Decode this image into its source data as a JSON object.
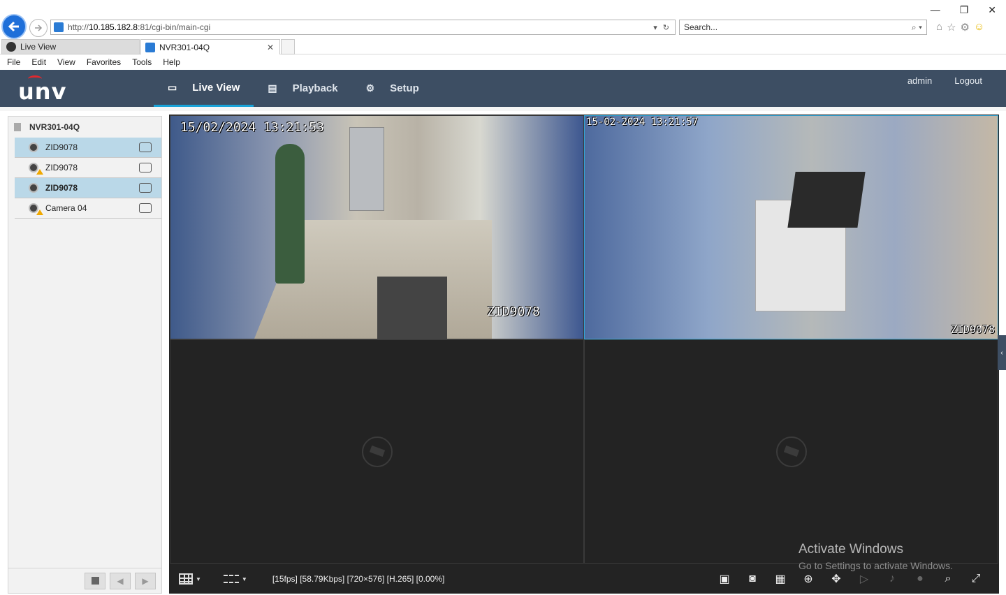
{
  "browser": {
    "url_prefix": "http://",
    "url_host": "10.185.182.8",
    "url_path": ":81/cgi-bin/main-cgi",
    "search_placeholder": "Search...",
    "tabs": [
      {
        "label": "Live View"
      },
      {
        "label": "NVR301-04Q"
      }
    ],
    "menu": [
      "File",
      "Edit",
      "View",
      "Favorites",
      "Tools",
      "Help"
    ]
  },
  "app": {
    "logo": "unv",
    "nav": [
      {
        "label": "Live View",
        "icon": "monitor-icon"
      },
      {
        "label": "Playback",
        "icon": "film-icon"
      },
      {
        "label": "Setup",
        "icon": "gear-icon"
      }
    ],
    "user": "admin",
    "logout": "Logout"
  },
  "sidebar": {
    "root": "NVR301-04Q",
    "cameras": [
      {
        "name": "ZID9078",
        "selected": true,
        "warning": false
      },
      {
        "name": "ZID9078",
        "selected": false,
        "warning": true
      },
      {
        "name": "ZID9078",
        "selected": true,
        "warning": false
      },
      {
        "name": "Camera 04",
        "selected": false,
        "warning": true
      }
    ]
  },
  "video": {
    "panes": [
      {
        "timestamp": "15/02/2024 13:21:53",
        "name": "ZID9078"
      },
      {
        "timestamp": "15-02-2024 13:21:57",
        "name": "ZID9078"
      }
    ]
  },
  "toolbar": {
    "stream_info": "[15fps] [58.79Kbps] [720×576] [H.265] [0.00%]"
  },
  "watermark": {
    "line1": "Activate Windows",
    "line2": "Go to Settings to activate Windows."
  },
  "colors": {
    "header": "#3d4e63",
    "accent": "#1aa3d8",
    "selected_row": "#bad8e8"
  }
}
